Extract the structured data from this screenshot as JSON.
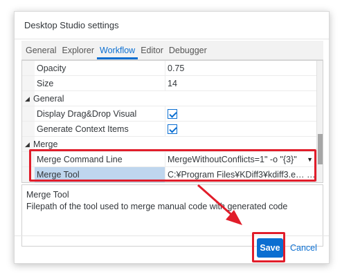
{
  "dialog": {
    "title": "Desktop Studio settings"
  },
  "tabs": [
    {
      "label": "General",
      "active": false
    },
    {
      "label": "Explorer",
      "active": false
    },
    {
      "label": "Workflow",
      "active": true
    },
    {
      "label": "Editor",
      "active": false
    },
    {
      "label": "Debugger",
      "active": false
    }
  ],
  "grid": {
    "rows": [
      {
        "name": "Opacity",
        "value": "0.75"
      },
      {
        "name": "Size",
        "value": "14"
      },
      {
        "category": "General"
      },
      {
        "name": "Display Drag&Drop Visual",
        "checked": true
      },
      {
        "name": "Generate Context Items",
        "checked": true
      },
      {
        "category": "Merge"
      },
      {
        "name": "Merge Command Line",
        "value": "MergeWithoutConflicts=1\" -o \"{3}\""
      },
      {
        "name": "Merge Tool",
        "value": "C:¥Program Files¥KDiff3¥kdiff3.e… …",
        "selected": true
      }
    ]
  },
  "description": {
    "title": "Merge Tool",
    "text": "Filepath of the tool used to merge manual code with generated code"
  },
  "buttons": {
    "save": "Save",
    "cancel": "Cancel"
  },
  "colors": {
    "accent": "#0a6ed1",
    "annotation": "#e11d2a",
    "selection": "#bfd6ee"
  },
  "icons": {
    "expanded": "triangle-expanded-icon",
    "checkbox": "checkmark-icon",
    "dropdown": "chevron-down-icon"
  }
}
